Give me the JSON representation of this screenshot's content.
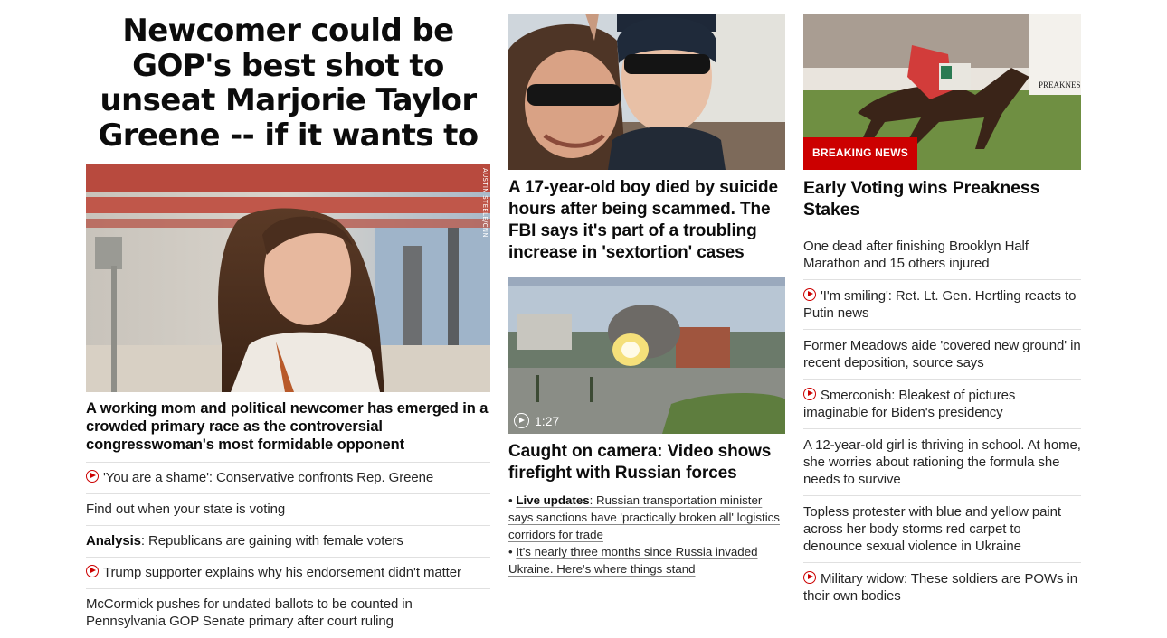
{
  "col1": {
    "headline": "Newcomer could be GOP's best shot to unseat Marjorie Taylor Greene -- if it wants to",
    "image_credit": "AUSTIN STEELE/CNN",
    "lead": "A working mom and political newcomer has emerged in a crowded primary race as the controversial congresswoman's most formidable opponent",
    "items": [
      {
        "video": true,
        "prefix": "",
        "text": "'You are a shame': Conservative confronts Rep. Greene"
      },
      {
        "video": false,
        "prefix": "",
        "text": "Find out when your state is voting"
      },
      {
        "video": false,
        "prefix": "Analysis",
        "text": ": Republicans are gaining with female voters"
      },
      {
        "video": true,
        "prefix": "",
        "text": "Trump supporter explains why his endorsement didn't matter"
      },
      {
        "video": false,
        "prefix": "",
        "text": "McCormick pushes for undated ballots to be counted in Pennsylvania GOP Senate primary after court ruling"
      }
    ]
  },
  "col2": {
    "story1_headline": "A 17-year-old boy died by suicide hours after being scammed. The FBI says it's part of a troubling increase in 'sextortion' cases",
    "video_duration": "1:27",
    "story2_headline": "Caught on camera: Video shows firefight with Russian forces",
    "bullets": [
      {
        "bold": "Live updates",
        "text": ": Russian transportation minister says sanctions have 'practically broken all' logistics corridors for trade"
      },
      {
        "bold": "",
        "text": "It's nearly three months since Russia invaded Ukraine. Here's where things stand"
      }
    ]
  },
  "col3": {
    "badge": "BREAKING NEWS",
    "headline": "Early Voting wins Preakness Stakes",
    "items": [
      {
        "video": false,
        "text": "One dead after finishing Brooklyn Half Marathon and 15 others injured"
      },
      {
        "video": true,
        "text": "'I'm smiling': Ret. Lt. Gen. Hertling reacts to Putin news"
      },
      {
        "video": false,
        "text": "Former Meadows aide 'covered new ground' in recent deposition, source says"
      },
      {
        "video": true,
        "text": "Smerconish: Bleakest of pictures imaginable for Biden's presidency"
      },
      {
        "video": false,
        "text": "A 12-year-old girl is thriving in school. At home, she worries about rationing the formula she needs to survive"
      },
      {
        "video": false,
        "text": "Topless protester with blue and yellow paint across her body storms red carpet to denounce sexual violence in Ukraine"
      },
      {
        "video": true,
        "text": "Military widow: These soldiers are POWs in their own bodies"
      }
    ]
  },
  "colors": {
    "accent": "#cc0000",
    "divider": "#e0e0e0",
    "text": "#262626"
  },
  "icons": {
    "video": "play-circle-icon"
  }
}
